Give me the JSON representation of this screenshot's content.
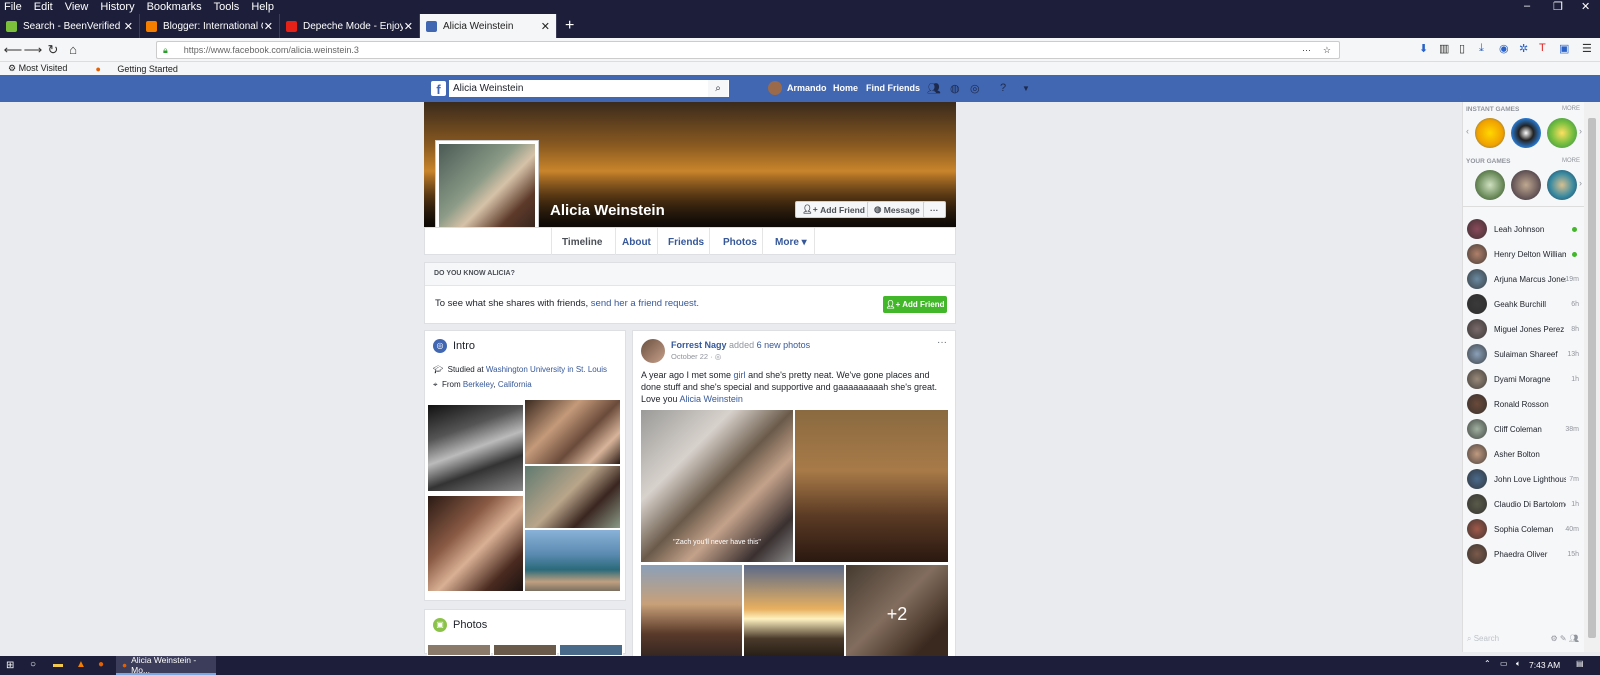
{
  "menubar": {
    "items": [
      "File",
      "Edit",
      "View",
      "History",
      "Bookmarks",
      "Tools",
      "Help"
    ]
  },
  "window_controls": {
    "minimize": "–",
    "restore": "❐",
    "close": "✕"
  },
  "tabs": [
    {
      "label": "Search - BeenVerified",
      "color": "#7bbf3a"
    },
    {
      "label": "Blogger: International Order Of...",
      "color": "#f57d00"
    },
    {
      "label": "Depeche Mode - Enjoy The...",
      "color": "#e62117"
    },
    {
      "label": "Alicia Weinstein",
      "color": "#4267b2"
    }
  ],
  "browser": {
    "url": "https://www.facebook.com/alicia.weinstein.3",
    "bookmarks": [
      "Most Visited",
      "Getting Started"
    ]
  },
  "fb": {
    "search_value": "Alicia Weinstein",
    "user": "Armando",
    "home": "Home",
    "find_friends": "Find Friends"
  },
  "profile": {
    "name": "Alicia Weinstein",
    "add_friend": "Add Friend",
    "message": "Message",
    "more_dots": "···",
    "tabs": [
      "Timeline",
      "About",
      "Friends",
      "Photos",
      "More ▾"
    ]
  },
  "know": {
    "heading": "DO YOU KNOW ALICIA?",
    "text": "To see what she shares with friends,",
    "link": "send her a friend request.",
    "button": "Add Friend"
  },
  "intro": {
    "title": "Intro",
    "studied_prefix": "Studied at",
    "studied_link": "Washington University in St. Louis",
    "from_prefix": "From",
    "from_city": "Berkeley",
    "from_sep": ",",
    "from_state": "California"
  },
  "photos": {
    "title": "Photos"
  },
  "post": {
    "author": "Forrest Nagy",
    "action": "added",
    "count_link": "6 new photos",
    "date": "October 22 · ",
    "body_1": "A year ago I met some ",
    "body_girl": "girl",
    "body_2": " and she's pretty neat. We've gone places and done stuff and she's special and supportive and gaaaaaaaaah she's great. Love you ",
    "body_name": "Alicia Weinstein",
    "caption": "\"Zach you'll never have this\"",
    "more_count": "+2"
  },
  "sidebar": {
    "instant_games": "INSTANT GAMES",
    "your_games": "YOUR GAMES",
    "more": "MORE",
    "search_placeholder": "Search",
    "contacts": [
      {
        "name": "Leah Johnson",
        "time": "",
        "online": true
      },
      {
        "name": "Henry Delton Williams",
        "time": "",
        "online": true
      },
      {
        "name": "Arjuna Marcus Jones",
        "time": "19m"
      },
      {
        "name": "Geahk Burchill",
        "time": "6h"
      },
      {
        "name": "Miguel Jones Perez",
        "time": "8h"
      },
      {
        "name": "Sulaiman Shareef",
        "time": "13h"
      },
      {
        "name": "Dyami Moragne",
        "time": "1h"
      },
      {
        "name": "Ronald Rosson",
        "time": ""
      },
      {
        "name": "Cliff Coleman",
        "time": "38m"
      },
      {
        "name": "Asher Bolton",
        "time": ""
      },
      {
        "name": "John Love Lighthouse",
        "time": "7m"
      },
      {
        "name": "Claudio Di Bartolomei",
        "time": "1h"
      },
      {
        "name": "Sophia Coleman",
        "time": "40m"
      },
      {
        "name": "Phaedra Oliver",
        "time": "15h"
      }
    ]
  },
  "taskbar": {
    "active_window": "Alicia Weinstein - Mo...",
    "time": "7:43 AM"
  }
}
